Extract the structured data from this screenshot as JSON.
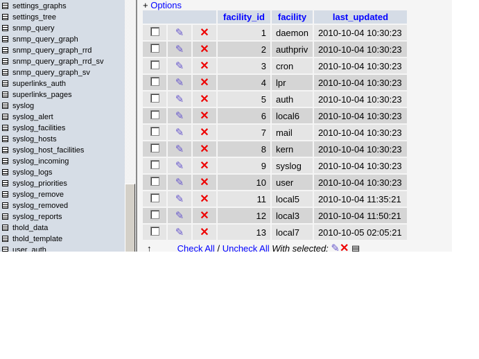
{
  "sidebar": {
    "items": [
      "settings_graphs",
      "settings_tree",
      "snmp_query",
      "snmp_query_graph",
      "snmp_query_graph_rrd",
      "snmp_query_graph_rrd_sv",
      "snmp_query_graph_sv",
      "superlinks_auth",
      "superlinks_pages",
      "syslog",
      "syslog_alert",
      "syslog_facilities",
      "syslog_hosts",
      "syslog_host_facilities",
      "syslog_incoming",
      "syslog_logs",
      "syslog_priorities",
      "syslog_remove",
      "syslog_removed",
      "syslog_reports",
      "thold_data",
      "thold_template",
      "user_auth"
    ]
  },
  "main": {
    "options_label": "Options",
    "options_prefix": "+",
    "columns": [
      "facility_id",
      "facility",
      "last_updated"
    ],
    "rows": [
      [
        "1",
        "daemon",
        "2010-10-04 10:30:23"
      ],
      [
        "2",
        "authpriv",
        "2010-10-04 10:30:23"
      ],
      [
        "3",
        "cron",
        "2010-10-04 10:30:23"
      ],
      [
        "4",
        "lpr",
        "2010-10-04 10:30:23"
      ],
      [
        "5",
        "auth",
        "2010-10-04 10:30:23"
      ],
      [
        "6",
        "local6",
        "2010-10-04 10:30:23"
      ],
      [
        "7",
        "mail",
        "2010-10-04 10:30:23"
      ],
      [
        "8",
        "kern",
        "2010-10-04 10:30:23"
      ],
      [
        "9",
        "syslog",
        "2010-10-04 10:30:23"
      ],
      [
        "10",
        "user",
        "2010-10-04 10:30:23"
      ],
      [
        "11",
        "local5",
        "2010-10-04 11:35:21"
      ],
      [
        "12",
        "local3",
        "2010-10-04 11:50:21"
      ],
      [
        "13",
        "local7",
        "2010-10-05 02:05:21"
      ]
    ],
    "footer": {
      "check_all": "Check All",
      "separator": "/",
      "uncheck_all": "Uncheck All",
      "with_selected": "With selected:"
    }
  },
  "colors": {
    "link": "#0000ff",
    "header_bg": "#d5dce6",
    "sidebar_bg": "#d6dde6",
    "delete": "#e00000"
  }
}
